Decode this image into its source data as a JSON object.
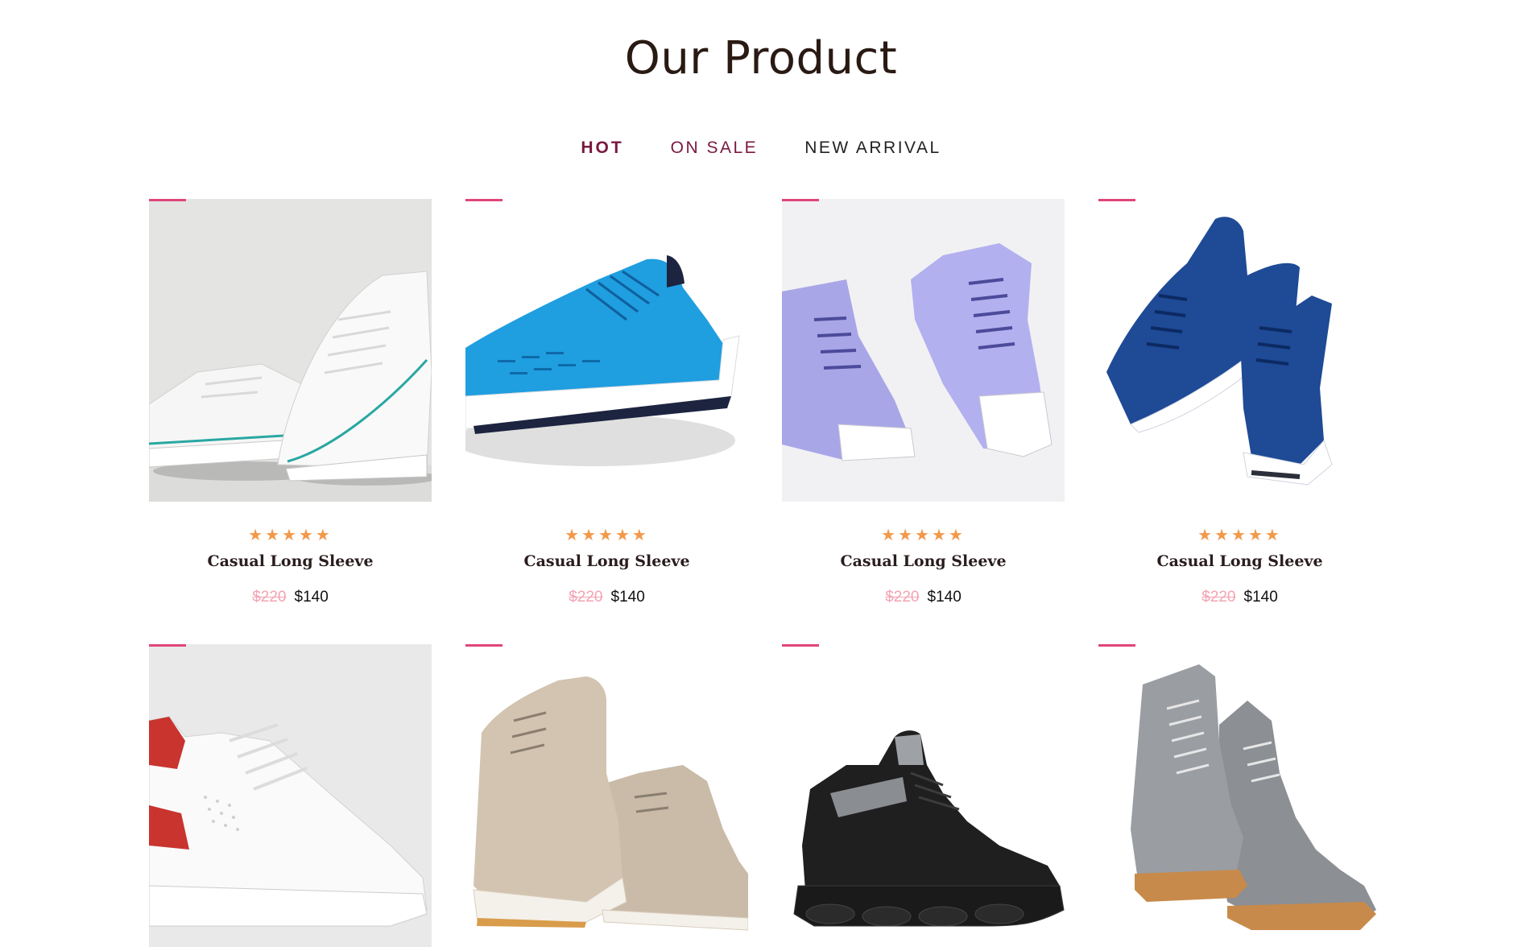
{
  "section": {
    "title": "Our Product"
  },
  "tabs": [
    {
      "label": "HOT",
      "active": true
    },
    {
      "label": "ON SALE",
      "active": false
    },
    {
      "label": "NEW ARRIVAL",
      "active": false
    }
  ],
  "colors": {
    "accent": "#e0457c",
    "tab_active": "#7a1840",
    "stars": "#f2994a",
    "old_price": "#f3a3b3"
  },
  "products": [
    {
      "image": "white-canvas-sneakers",
      "rating": 5,
      "stars": "★★★★★",
      "name": "Casual Long Sleeve",
      "old_price": "$220",
      "price": "$140"
    },
    {
      "image": "blue-running-shoe",
      "rating": 5,
      "stars": "★★★★★",
      "name": "Casual Long Sleeve",
      "old_price": "$220",
      "price": "$140"
    },
    {
      "image": "lavender-high-top-sneakers",
      "rating": 5,
      "stars": "★★★★★",
      "name": "Casual Long Sleeve",
      "old_price": "$220",
      "price": "$140"
    },
    {
      "image": "navy-knit-sneakers",
      "rating": 5,
      "stars": "★★★★★",
      "name": "Casual Long Sleeve",
      "old_price": "$220",
      "price": "$140"
    },
    {
      "image": "white-leather-sneaker"
    },
    {
      "image": "beige-suede-sneakers"
    },
    {
      "image": "black-chunky-sneaker"
    },
    {
      "image": "grey-suede-boots"
    }
  ]
}
